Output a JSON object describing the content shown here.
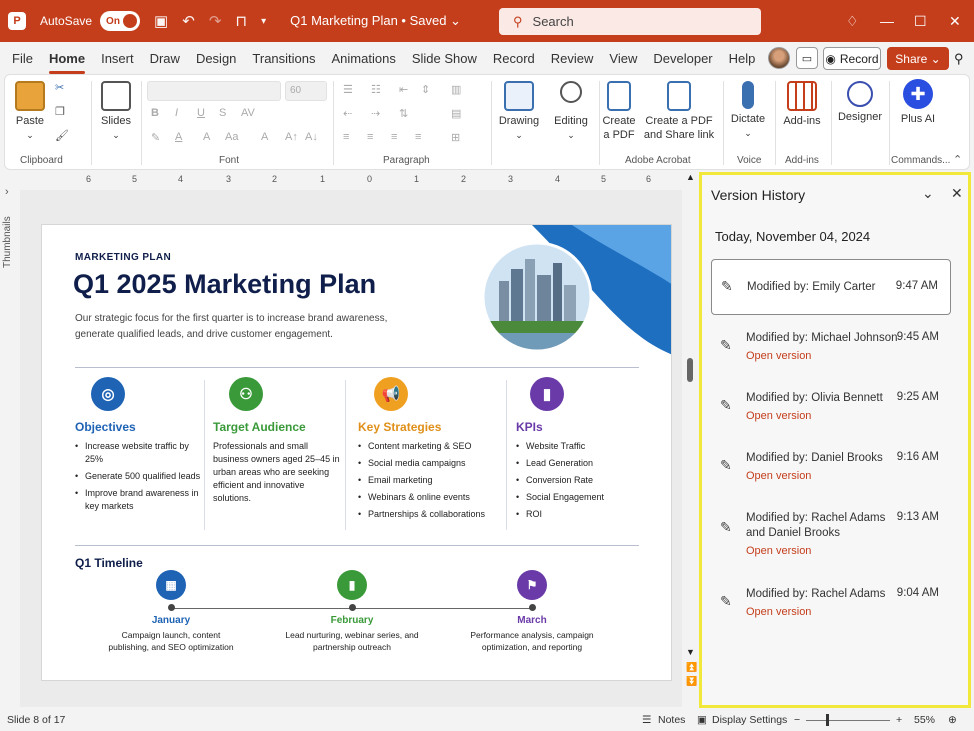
{
  "titlebar": {
    "autosave_label": "AutoSave",
    "autosave_state": "On",
    "doc_title": "Q1 Marketing Plan • Saved ⌄",
    "search_placeholder": "Search"
  },
  "menu": {
    "tabs": [
      "File",
      "Home",
      "Insert",
      "Draw",
      "Design",
      "Transitions",
      "Animations",
      "Slide Show",
      "Record",
      "Review",
      "View",
      "Developer",
      "Help"
    ],
    "active_tab": "Home",
    "record_label": "Record",
    "share_label": "Share ⌄"
  },
  "ribbon": {
    "clipboard": {
      "paste": "Paste",
      "group": "Clipboard"
    },
    "slides": {
      "label": "Slides",
      "group": ""
    },
    "font": {
      "size": "60",
      "group": "Font"
    },
    "paragraph": {
      "group": "Paragraph"
    },
    "drawing": {
      "label": "Drawing"
    },
    "editing": {
      "label": "Editing"
    },
    "acrobat": {
      "create_pdf": "Create a PDF",
      "create_share": "Create a PDF and Share link",
      "group": "Adobe Acrobat"
    },
    "voice": {
      "dictate": "Dictate",
      "group": "Voice"
    },
    "addins": {
      "label": "Add-ins",
      "group": "Add-ins"
    },
    "designer": {
      "label": "Designer"
    },
    "plus_ai": {
      "label": "Plus AI",
      "group": "Commands..."
    }
  },
  "left_rail": {
    "thumbnails_label": "Thumbnails"
  },
  "ruler": {
    "ticks": [
      "6",
      "5",
      "4",
      "3",
      "2",
      "1",
      "0",
      "1",
      "2",
      "3",
      "4",
      "5",
      "6"
    ]
  },
  "slide": {
    "kicker": "MARKETING PLAN",
    "title": "Q1 2025 Marketing Plan",
    "subtitle": "Our strategic focus for the first quarter is to increase brand awareness, generate qualified leads, and drive customer engagement.",
    "objectives": {
      "heading": "Objectives",
      "items": [
        "Increase website traffic by 25%",
        "Generate 500 qualified leads",
        "Improve brand awareness in key markets"
      ]
    },
    "audience": {
      "heading": "Target Audience",
      "text": "Professionals and small business owners aged 25–45 in urban areas who are seeking efficient and innovative solutions."
    },
    "strategies": {
      "heading": "Key Strategies",
      "items": [
        "Content marketing & SEO",
        "Social media campaigns",
        "Email marketing",
        "Webinars & online events",
        "Partnerships & collaborations"
      ]
    },
    "kpis": {
      "heading": "KPIs",
      "items": [
        "Website Traffic",
        "Lead Generation",
        "Conversion Rate",
        "Social Engagement",
        "ROI"
      ]
    },
    "timeline": {
      "heading": "Q1 Timeline",
      "nodes": [
        {
          "month": "January",
          "desc": "Campaign launch, content publishing, and SEO optimization"
        },
        {
          "month": "February",
          "desc": "Lead nurturing, webinar series, and partnership outreach"
        },
        {
          "month": "March",
          "desc": "Performance analysis, campaign optimization, and reporting"
        }
      ]
    }
  },
  "version_history": {
    "title": "Version History",
    "date": "Today, November 04, 2024",
    "open_label": "Open version",
    "entries": [
      {
        "who": "Modified by: Emily Carter",
        "time": "9:47 AM"
      },
      {
        "who": "Modified by: Michael Johnson",
        "time": "9:45 AM"
      },
      {
        "who": "Modified by: Olivia Bennett",
        "time": "9:25 AM"
      },
      {
        "who": "Modified by: Daniel Brooks",
        "time": "9:16 AM"
      },
      {
        "who": "Modified by: Rachel Adams and Daniel Brooks",
        "time": "9:13 AM"
      },
      {
        "who": "Modified by: Rachel Adams",
        "time": "9:04 AM"
      }
    ]
  },
  "statusbar": {
    "slide_info": "Slide 8 of 17",
    "notes": "Notes",
    "display_settings": "Display Settings",
    "zoom": "55%"
  },
  "colors": {
    "accent": "#c43e1c",
    "navy": "#0f1e4a",
    "highlight": "#f2e83a"
  }
}
